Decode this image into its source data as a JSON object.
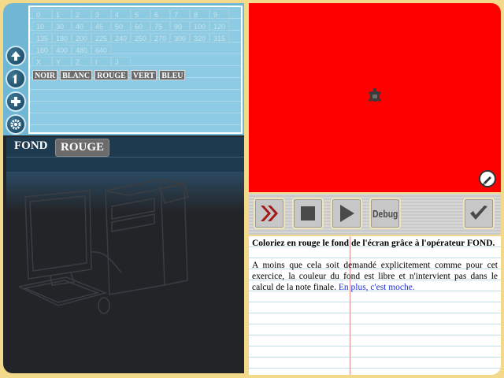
{
  "palette": {
    "numbers_row1": [
      "0",
      "1",
      "2",
      "3",
      "4",
      "5",
      "6",
      "7",
      "8",
      "9"
    ],
    "numbers_row2": [
      "10",
      "30",
      "40",
      "45",
      "50",
      "60",
      "75",
      "90",
      "100",
      "120"
    ],
    "numbers_row3": [
      "135",
      "180",
      "200",
      "225",
      "240",
      "250",
      "270",
      "300",
      "320",
      "315"
    ],
    "numbers_row4": [
      "160",
      "400",
      "480",
      "640"
    ],
    "vars_row": [
      "X",
      "Y",
      "Z",
      "I",
      "J"
    ],
    "colors": [
      "NOIR",
      "BLANC",
      "ROUGE",
      "VERT",
      "BLEU"
    ]
  },
  "side_tools": {
    "icons": [
      "arrow-up-icon",
      "one-icon",
      "plus-icon",
      "gear-icon"
    ]
  },
  "code": {
    "keyword": "FOND",
    "argument": "ROUGE"
  },
  "canvas": {
    "background_color": "#ff0000"
  },
  "controls": {
    "debug_label": "Debug"
  },
  "instructions": {
    "title": "Coloriez en rouge le fond de l'écran grâce à l'opérateur FOND.",
    "body": "A moins que cela soit demandé explicitement comme pour cet exercice, la couleur du fond est libre et n'intervient pas dans le calcul de la note finale.",
    "link": "En plus, c'est moche."
  }
}
